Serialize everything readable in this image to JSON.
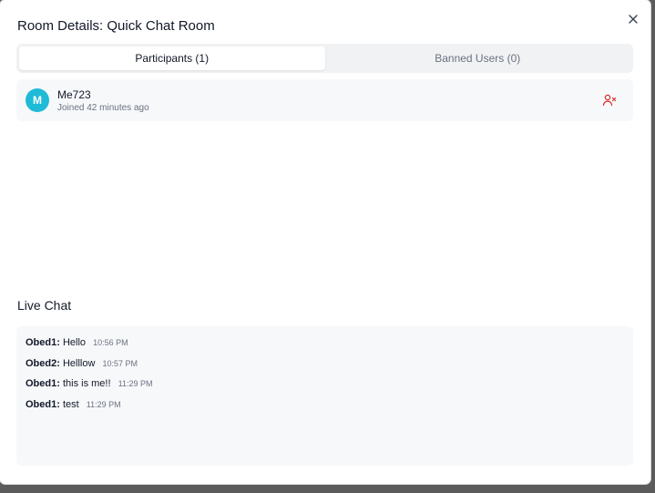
{
  "dialog": {
    "title": "Room Details: Quick Chat Room",
    "close_icon": "close-icon"
  },
  "tabs": [
    {
      "label": "Participants (1)",
      "active": true
    },
    {
      "label": "Banned Users (0)",
      "active": false
    }
  ],
  "participants": [
    {
      "initial": "M",
      "name": "Me723",
      "joined": "Joined 42 minutes ago",
      "action_icon": "ban-user-icon",
      "avatar_color": "#1ebbd7"
    }
  ],
  "live_chat": {
    "title": "Live Chat",
    "messages": [
      {
        "user": "Obed1:",
        "text": "Hello",
        "time": "10:56 PM"
      },
      {
        "user": "Obed2:",
        "text": "Helllow",
        "time": "10:57 PM"
      },
      {
        "user": "Obed1:",
        "text": "this is me!!",
        "time": "11:29 PM"
      },
      {
        "user": "Obed1:",
        "text": "test",
        "time": "11:29 PM"
      }
    ]
  },
  "colors": {
    "accent_avatar": "#1ebbd7",
    "danger": "#dc2626",
    "panel_bg": "#f7f8fa"
  }
}
